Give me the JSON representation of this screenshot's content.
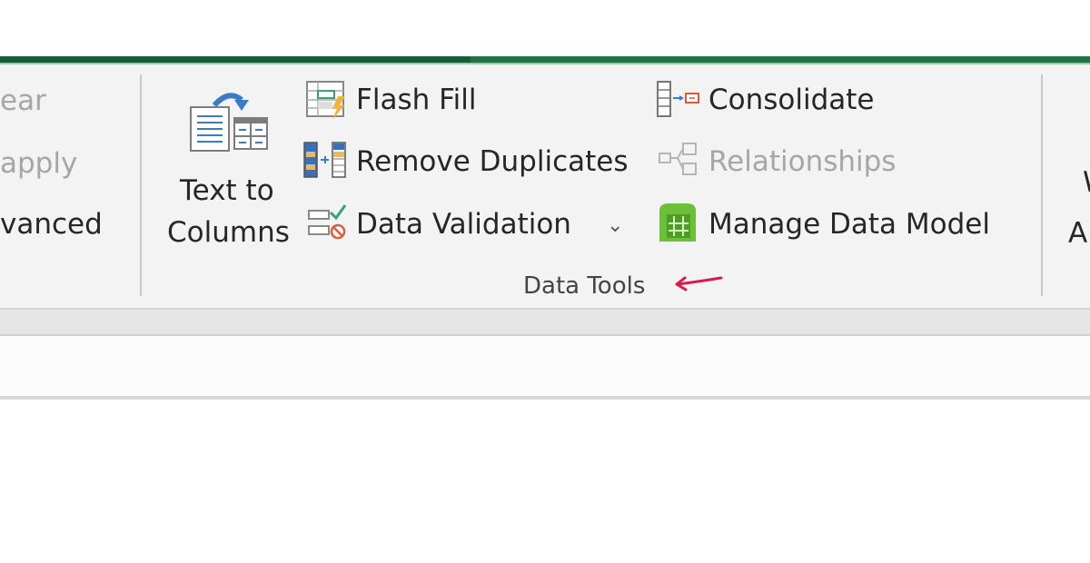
{
  "ribbon": {
    "left_group_partial": {
      "clear_label": "ear",
      "reapply_label": "apply",
      "advanced_label": "vanced"
    },
    "data_tools": {
      "group_label": "Data Tools",
      "text_to_columns": {
        "line1": "Text to",
        "line2": "Columns",
        "icon": "text-to-columns-icon"
      },
      "flash_fill": {
        "label": "Flash Fill",
        "icon": "flash-fill-icon"
      },
      "remove_duplicates": {
        "label": "Remove Duplicates",
        "icon": "remove-duplicates-icon"
      },
      "data_validation": {
        "label": "Data Validation",
        "icon": "data-validation-icon",
        "dropdown": "⌄"
      },
      "consolidate": {
        "label": "Consolidate",
        "icon": "consolidate-icon"
      },
      "relationships": {
        "label": "Relationships",
        "icon": "relationships-icon",
        "enabled": false
      },
      "manage_data_model": {
        "label": "Manage Data Model",
        "icon": "data-model-icon"
      }
    },
    "right_group_partial": {
      "line1": "W",
      "line2": "A"
    }
  },
  "annotation": {
    "arrow_color": "#d81b4a"
  },
  "colors": {
    "excel_green": "#217346",
    "excel_dark_green": "#185c37",
    "ribbon_bg": "#f3f3f3"
  }
}
